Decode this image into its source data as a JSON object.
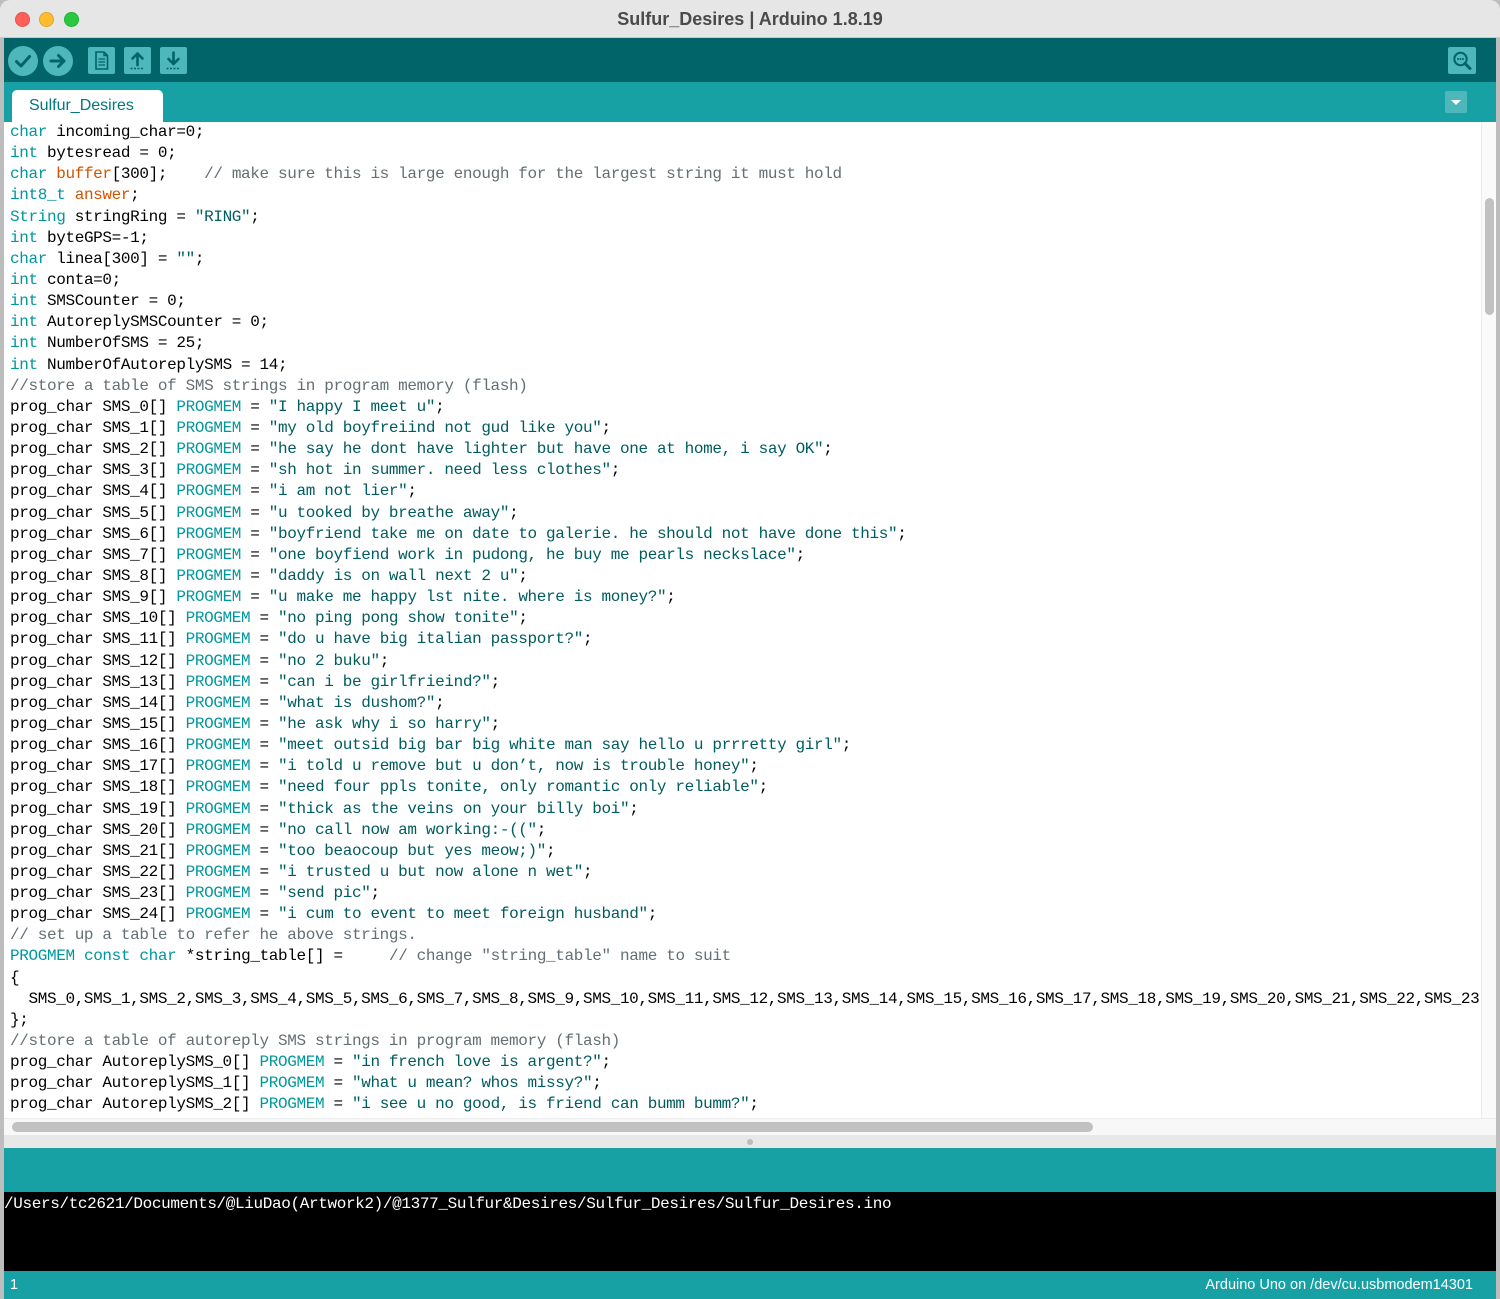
{
  "window": {
    "title": "Sulfur_Desires | Arduino 1.8.19",
    "traffic_lights": [
      {
        "icon": "close-window-icon",
        "color": "#fe5f57"
      },
      {
        "icon": "minimize-window-icon",
        "color": "#febc2e"
      },
      {
        "icon": "zoom-window-icon",
        "color": "#28c840"
      }
    ]
  },
  "theme": {
    "toolbar_bg": "#006468",
    "header_bg": "#17a1a5",
    "button_bg": "#4db7bb",
    "editor_bg": "#ffffff",
    "console_bg": "#000000",
    "console_text": "#ffffff"
  },
  "toolbar": {
    "buttons": [
      {
        "icon": "verify-icon"
      },
      {
        "icon": "upload-icon"
      },
      {
        "icon": "new-sketch-icon"
      },
      {
        "icon": "open-sketch-icon"
      },
      {
        "icon": "save-sketch-icon"
      }
    ],
    "serial_monitor": {
      "icon": "serial-monitor-icon"
    }
  },
  "tabs": [
    {
      "label": "Sulfur_Desires"
    }
  ],
  "tab_menu": {
    "icon": "chevron-down-icon"
  },
  "editor": {
    "syntax_colors": {
      "k": "#00979c",
      "v": "#d35400",
      "s": "#005c5f",
      "c": "#646f74",
      "t": "#000000"
    },
    "lines": [
      [
        [
          "k",
          "char"
        ],
        [
          "t",
          " incoming_char=0;"
        ]
      ],
      [
        [
          "k",
          "int"
        ],
        [
          "t",
          " bytesread = 0;"
        ]
      ],
      [
        [
          "k",
          "char"
        ],
        [
          "t",
          " "
        ],
        [
          "v",
          "buffer"
        ],
        [
          "t",
          "[300];    "
        ],
        [
          "c",
          "// make sure this is large enough for the largest string it must hold"
        ]
      ],
      [
        [
          "k",
          "int8_t"
        ],
        [
          "t",
          " "
        ],
        [
          "v",
          "answer"
        ],
        [
          "t",
          ";"
        ]
      ],
      [
        [
          "k",
          "String"
        ],
        [
          "t",
          " stringRing = "
        ],
        [
          "s",
          "\"RING\""
        ],
        [
          "t",
          ";"
        ]
      ],
      [
        [
          "k",
          "int"
        ],
        [
          "t",
          " byteGPS=-1;"
        ]
      ],
      [
        [
          "k",
          "char"
        ],
        [
          "t",
          " linea[300] = "
        ],
        [
          "s",
          "\"\""
        ],
        [
          "t",
          ";"
        ]
      ],
      [
        [
          "k",
          "int"
        ],
        [
          "t",
          " conta=0;"
        ]
      ],
      [
        [
          "k",
          "int"
        ],
        [
          "t",
          " SMSCounter = 0;"
        ]
      ],
      [
        [
          "k",
          "int"
        ],
        [
          "t",
          " AutoreplySMSCounter = 0;"
        ]
      ],
      [
        [
          "k",
          "int"
        ],
        [
          "t",
          " NumberOfSMS = 25;"
        ]
      ],
      [
        [
          "k",
          "int"
        ],
        [
          "t",
          " NumberOfAutoreplySMS = 14;"
        ]
      ],
      [
        [
          "c",
          "//store a table of SMS strings in program memory (flash)"
        ]
      ],
      [
        [
          "t",
          "prog_char SMS_0[] "
        ],
        [
          "k",
          "PROGMEM"
        ],
        [
          "t",
          " = "
        ],
        [
          "s",
          "\"I happy I meet u\""
        ],
        [
          "t",
          ";"
        ]
      ],
      [
        [
          "t",
          "prog_char SMS_1[] "
        ],
        [
          "k",
          "PROGMEM"
        ],
        [
          "t",
          " = "
        ],
        [
          "s",
          "\"my old boyfreiind not gud like you\""
        ],
        [
          "t",
          ";"
        ]
      ],
      [
        [
          "t",
          "prog_char SMS_2[] "
        ],
        [
          "k",
          "PROGMEM"
        ],
        [
          "t",
          " = "
        ],
        [
          "s",
          "\"he say he dont have lighter but have one at home, i say OK\""
        ],
        [
          "t",
          ";"
        ]
      ],
      [
        [
          "t",
          "prog_char SMS_3[] "
        ],
        [
          "k",
          "PROGMEM"
        ],
        [
          "t",
          " = "
        ],
        [
          "s",
          "\"sh hot in summer. need less clothes\""
        ],
        [
          "t",
          ";"
        ]
      ],
      [
        [
          "t",
          "prog_char SMS_4[] "
        ],
        [
          "k",
          "PROGMEM"
        ],
        [
          "t",
          " = "
        ],
        [
          "s",
          "\"i am not lier\""
        ],
        [
          "t",
          ";"
        ]
      ],
      [
        [
          "t",
          "prog_char SMS_5[] "
        ],
        [
          "k",
          "PROGMEM"
        ],
        [
          "t",
          " = "
        ],
        [
          "s",
          "\"u tooked by breathe away\""
        ],
        [
          "t",
          ";"
        ]
      ],
      [
        [
          "t",
          "prog_char SMS_6[] "
        ],
        [
          "k",
          "PROGMEM"
        ],
        [
          "t",
          " = "
        ],
        [
          "s",
          "\"boyfriend take me on date to galerie. he should not have done this\""
        ],
        [
          "t",
          ";"
        ]
      ],
      [
        [
          "t",
          "prog_char SMS_7[] "
        ],
        [
          "k",
          "PROGMEM"
        ],
        [
          "t",
          " = "
        ],
        [
          "s",
          "\"one boyfiend work in pudong, he buy me pearls neckslace\""
        ],
        [
          "t",
          ";"
        ]
      ],
      [
        [
          "t",
          "prog_char SMS_8[] "
        ],
        [
          "k",
          "PROGMEM"
        ],
        [
          "t",
          " = "
        ],
        [
          "s",
          "\"daddy is on wall next 2 u\""
        ],
        [
          "t",
          ";"
        ]
      ],
      [
        [
          "t",
          "prog_char SMS_9[] "
        ],
        [
          "k",
          "PROGMEM"
        ],
        [
          "t",
          " = "
        ],
        [
          "s",
          "\"u make me happy lst nite. where is money?\""
        ],
        [
          "t",
          ";"
        ]
      ],
      [
        [
          "t",
          "prog_char SMS_10[] "
        ],
        [
          "k",
          "PROGMEM"
        ],
        [
          "t",
          " = "
        ],
        [
          "s",
          "\"no ping pong show tonite\""
        ],
        [
          "t",
          ";"
        ]
      ],
      [
        [
          "t",
          "prog_char SMS_11[] "
        ],
        [
          "k",
          "PROGMEM"
        ],
        [
          "t",
          " = "
        ],
        [
          "s",
          "\"do u have big italian passport?\""
        ],
        [
          "t",
          ";"
        ]
      ],
      [
        [
          "t",
          "prog_char SMS_12[] "
        ],
        [
          "k",
          "PROGMEM"
        ],
        [
          "t",
          " = "
        ],
        [
          "s",
          "\"no 2 buku\""
        ],
        [
          "t",
          ";"
        ]
      ],
      [
        [
          "t",
          "prog_char SMS_13[] "
        ],
        [
          "k",
          "PROGMEM"
        ],
        [
          "t",
          " = "
        ],
        [
          "s",
          "\"can i be girlfrieind?\""
        ],
        [
          "t",
          ";"
        ]
      ],
      [
        [
          "t",
          "prog_char SMS_14[] "
        ],
        [
          "k",
          "PROGMEM"
        ],
        [
          "t",
          " = "
        ],
        [
          "s",
          "\"what is dushom?\""
        ],
        [
          "t",
          ";"
        ]
      ],
      [
        [
          "t",
          "prog_char SMS_15[] "
        ],
        [
          "k",
          "PROGMEM"
        ],
        [
          "t",
          " = "
        ],
        [
          "s",
          "\"he ask why i so harry\""
        ],
        [
          "t",
          ";"
        ]
      ],
      [
        [
          "t",
          "prog_char SMS_16[] "
        ],
        [
          "k",
          "PROGMEM"
        ],
        [
          "t",
          " = "
        ],
        [
          "s",
          "\"meet outsid big bar big white man say hello u prrretty girl\""
        ],
        [
          "t",
          ";"
        ]
      ],
      [
        [
          "t",
          "prog_char SMS_17[] "
        ],
        [
          "k",
          "PROGMEM"
        ],
        [
          "t",
          " = "
        ],
        [
          "s",
          "\"i told u remove but u don’t, now is trouble honey\""
        ],
        [
          "t",
          ";"
        ]
      ],
      [
        [
          "t",
          "prog_char SMS_18[] "
        ],
        [
          "k",
          "PROGMEM"
        ],
        [
          "t",
          " = "
        ],
        [
          "s",
          "\"need four ppls tonite, only romantic only reliable\""
        ],
        [
          "t",
          ";"
        ]
      ],
      [
        [
          "t",
          "prog_char SMS_19[] "
        ],
        [
          "k",
          "PROGMEM"
        ],
        [
          "t",
          " = "
        ],
        [
          "s",
          "\"thick as the veins on your billy boi\""
        ],
        [
          "t",
          ";"
        ]
      ],
      [
        [
          "t",
          "prog_char SMS_20[] "
        ],
        [
          "k",
          "PROGMEM"
        ],
        [
          "t",
          " = "
        ],
        [
          "s",
          "\"no call now am working:-((\""
        ],
        [
          "t",
          ";"
        ]
      ],
      [
        [
          "t",
          "prog_char SMS_21[] "
        ],
        [
          "k",
          "PROGMEM"
        ],
        [
          "t",
          " = "
        ],
        [
          "s",
          "\"too beaocoup but yes meow;)\""
        ],
        [
          "t",
          ";"
        ]
      ],
      [
        [
          "t",
          "prog_char SMS_22[] "
        ],
        [
          "k",
          "PROGMEM"
        ],
        [
          "t",
          " = "
        ],
        [
          "s",
          "\"i trusted u but now alone n wet\""
        ],
        [
          "t",
          ";"
        ]
      ],
      [
        [
          "t",
          "prog_char SMS_23[] "
        ],
        [
          "k",
          "PROGMEM"
        ],
        [
          "t",
          " = "
        ],
        [
          "s",
          "\"send pic\""
        ],
        [
          "t",
          ";"
        ]
      ],
      [
        [
          "t",
          "prog_char SMS_24[] "
        ],
        [
          "k",
          "PROGMEM"
        ],
        [
          "t",
          " = "
        ],
        [
          "s",
          "\"i cum to event to meet foreign husband\""
        ],
        [
          "t",
          ";"
        ]
      ],
      [
        [
          "c",
          "// set up a table to refer he above strings."
        ]
      ],
      [
        [
          "k",
          "PROGMEM"
        ],
        [
          "t",
          " "
        ],
        [
          "k",
          "const"
        ],
        [
          "t",
          " "
        ],
        [
          "k",
          "char"
        ],
        [
          "t",
          " *string_table[] =     "
        ],
        [
          "c",
          "// change \"string_table\" name to suit"
        ]
      ],
      [
        [
          "t",
          "{"
        ]
      ],
      [
        [
          "t",
          "  SMS_0,SMS_1,SMS_2,SMS_3,SMS_4,SMS_5,SMS_6,SMS_7,SMS_8,SMS_9,SMS_10,SMS_11,SMS_12,SMS_13,SMS_14,SMS_15,SMS_16,SMS_17,SMS_18,SMS_19,SMS_20,SMS_21,SMS_22,SMS_23"
        ]
      ],
      [
        [
          "t",
          "};"
        ]
      ],
      [
        [
          "c",
          "//store a table of autoreply SMS strings in program memory (flash)"
        ]
      ],
      [
        [
          "t",
          "prog_char AutoreplySMS_0[] "
        ],
        [
          "k",
          "PROGMEM"
        ],
        [
          "t",
          " = "
        ],
        [
          "s",
          "\"in french love is argent?\""
        ],
        [
          "t",
          ";"
        ]
      ],
      [
        [
          "t",
          "prog_char AutoreplySMS_1[] "
        ],
        [
          "k",
          "PROGMEM"
        ],
        [
          "t",
          " = "
        ],
        [
          "s",
          "\"what u mean? whos missy?\""
        ],
        [
          "t",
          ";"
        ]
      ],
      [
        [
          "t",
          "prog_char AutoreplySMS_2[] "
        ],
        [
          "k",
          "PROGMEM"
        ],
        [
          "t",
          " = "
        ],
        [
          "s",
          "\"i see u no good, is friend can bumm bumm?\""
        ],
        [
          "t",
          ";"
        ]
      ]
    ]
  },
  "console": {
    "output": "/Users/tc2621/Documents/@LiuDao(Artwork2)/@1377_Sulfur&Desires/Sulfur_Desires/Sulfur_Desires.ino"
  },
  "status": {
    "line_number": "1",
    "board": "Arduino Uno on /dev/cu.usbmodem14301"
  }
}
